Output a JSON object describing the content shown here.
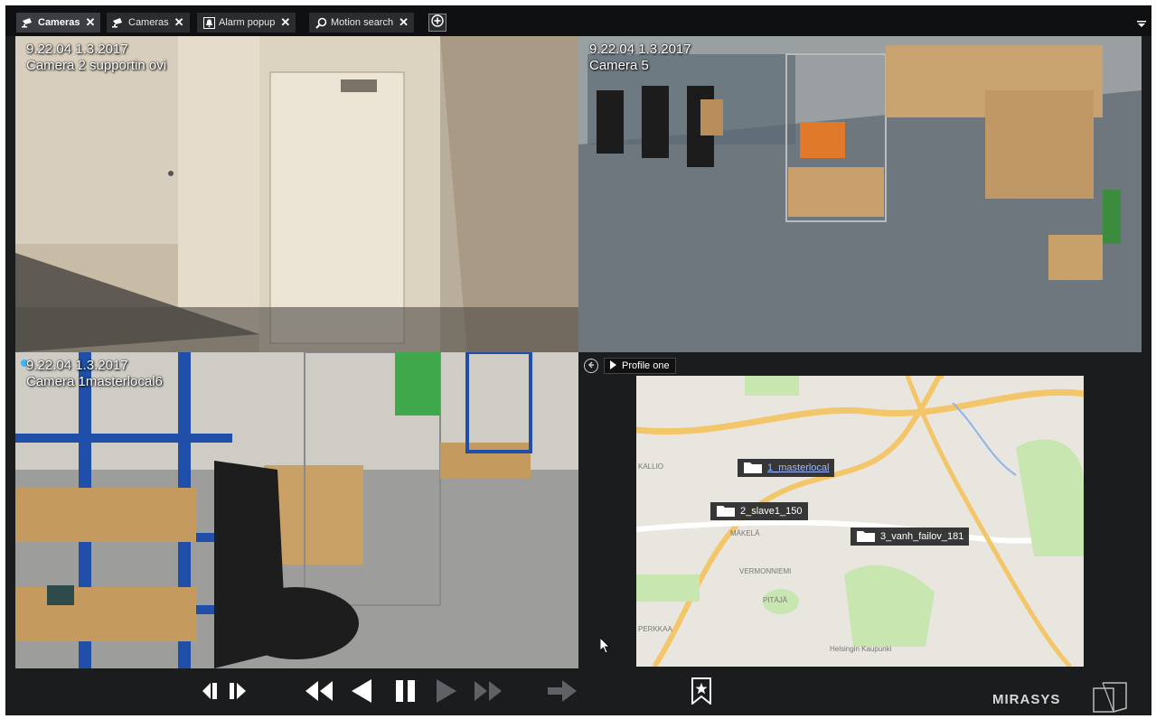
{
  "tabs": [
    {
      "label": "Cameras",
      "icon": "camera-icon",
      "active": true
    },
    {
      "label": "Cameras",
      "icon": "camera-icon",
      "active": false
    },
    {
      "label": "Alarm popup",
      "icon": "alarm-icon",
      "active": false
    },
    {
      "label": "Motion search",
      "icon": "search-icon",
      "active": false
    }
  ],
  "cameras": [
    {
      "timestamp": "9.22.04  1.3.2017",
      "name": "Camera 2 supportin ovi"
    },
    {
      "timestamp": "9.22.04  1.3.2017",
      "name": "Camera 5"
    },
    {
      "timestamp": "9.22.04  1.3.2017",
      "name": "Camera 1masterlocal6"
    }
  ],
  "map": {
    "profile_label": "Profile one",
    "sites": [
      {
        "label": "1_masterlocal"
      },
      {
        "label": "2_slave1_150"
      },
      {
        "label": "3_vanh_failov_181"
      }
    ],
    "place_names": [
      "KALLIO",
      "MÄKELÄ",
      "VERMONNIEMI",
      "PITÄJÄ",
      "PERKKAA",
      "Helsingin Kaupunki"
    ]
  },
  "toolbar": {
    "brand": "MIRASYS"
  },
  "colors": {
    "accent": "#38b6ff",
    "tab_active": "#3a3e42",
    "background": "#1a1c1e"
  }
}
